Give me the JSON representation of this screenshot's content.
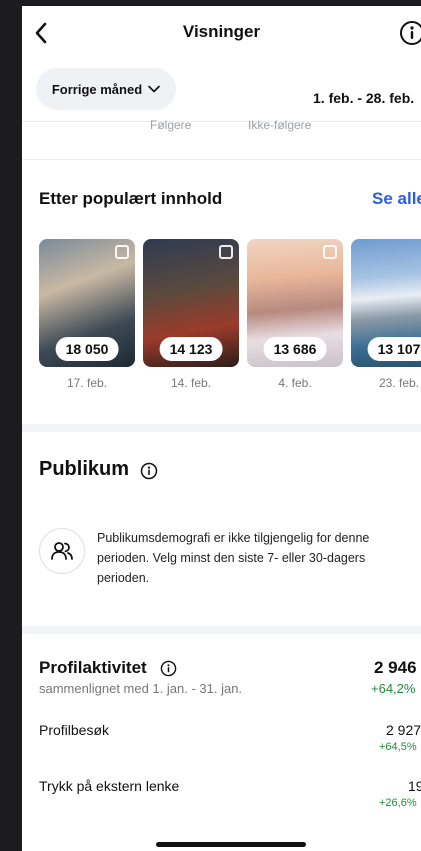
{
  "header": {
    "title": "Visninger",
    "back_icon": "chevron-left-icon",
    "info_icon": "info-icon"
  },
  "filter": {
    "period_label": "Forrige måned",
    "period_icon": "chevron-down-icon",
    "date_range": "1. feb. - 28. feb."
  },
  "stub": {
    "left": "Følgere",
    "right": "Ikke-følgere"
  },
  "popular": {
    "title": "Etter populært innhold",
    "see_all": "Se alle",
    "items": [
      {
        "value": "18 050",
        "date": "17. feb."
      },
      {
        "value": "14 123",
        "date": "14. feb."
      },
      {
        "value": "13 686",
        "date": "4. feb."
      },
      {
        "value": "13 107",
        "date": "23. feb."
      }
    ]
  },
  "audience": {
    "title": "Publikum",
    "info_icon": "info-icon",
    "icon": "people-icon",
    "message": "Publikumsdemografi er ikke tilgjengelig for denne perioden. Velg minst den siste 7- eller 30-dagers perioden."
  },
  "profile_activity": {
    "title": "Profilaktivitet",
    "info_icon": "info-icon",
    "comparison": "sammenlignet med 1. jan. - 31. jan.",
    "total": "2 946",
    "total_change": "+64,2%",
    "rows": [
      {
        "label": "Profilbesøk",
        "value": "2 927",
        "change": "+64,5%"
      },
      {
        "label": "Trykk på ekstern lenke",
        "value": "19",
        "change": "+26,6%"
      }
    ]
  },
  "colors": {
    "accent": "#2a5ee8",
    "positive": "#1e8a3c"
  }
}
